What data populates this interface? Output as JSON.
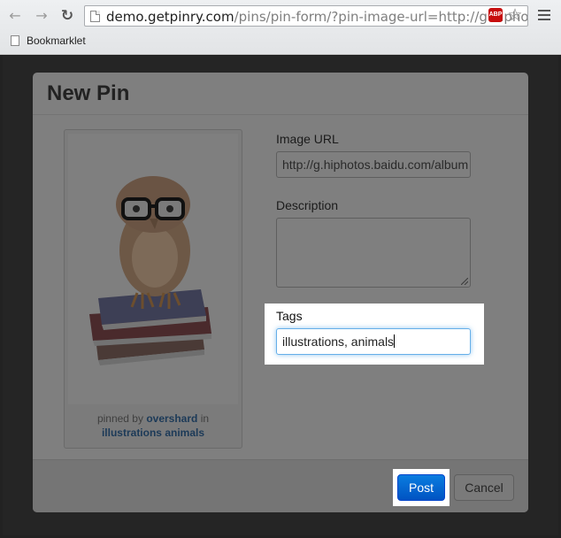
{
  "browser": {
    "url_host": "demo.getpinry.com",
    "url_rest": "/pins/pin-form/?pin-image-url=http://g.hiphotos",
    "abp_label": "ABP",
    "bookmarks": [
      {
        "label": "Bookmarklet"
      }
    ]
  },
  "modal": {
    "title": "New Pin",
    "pin": {
      "pinned_by_prefix": "pinned by",
      "author": "overshard",
      "in_text": "in",
      "tags_text": "illustrations animals"
    },
    "form": {
      "image_url_label": "Image URL",
      "image_url_value": "http://g.hiphotos.baidu.com/album",
      "description_label": "Description",
      "description_value": "",
      "tags_label": "Tags",
      "tags_value": "illustrations, animals"
    },
    "buttons": {
      "post": "Post",
      "cancel": "Cancel"
    }
  },
  "colors": {
    "accent": "#0a6fdb",
    "link": "#1c3a58",
    "overlay": "#252525",
    "highlight": "#ffffff"
  }
}
